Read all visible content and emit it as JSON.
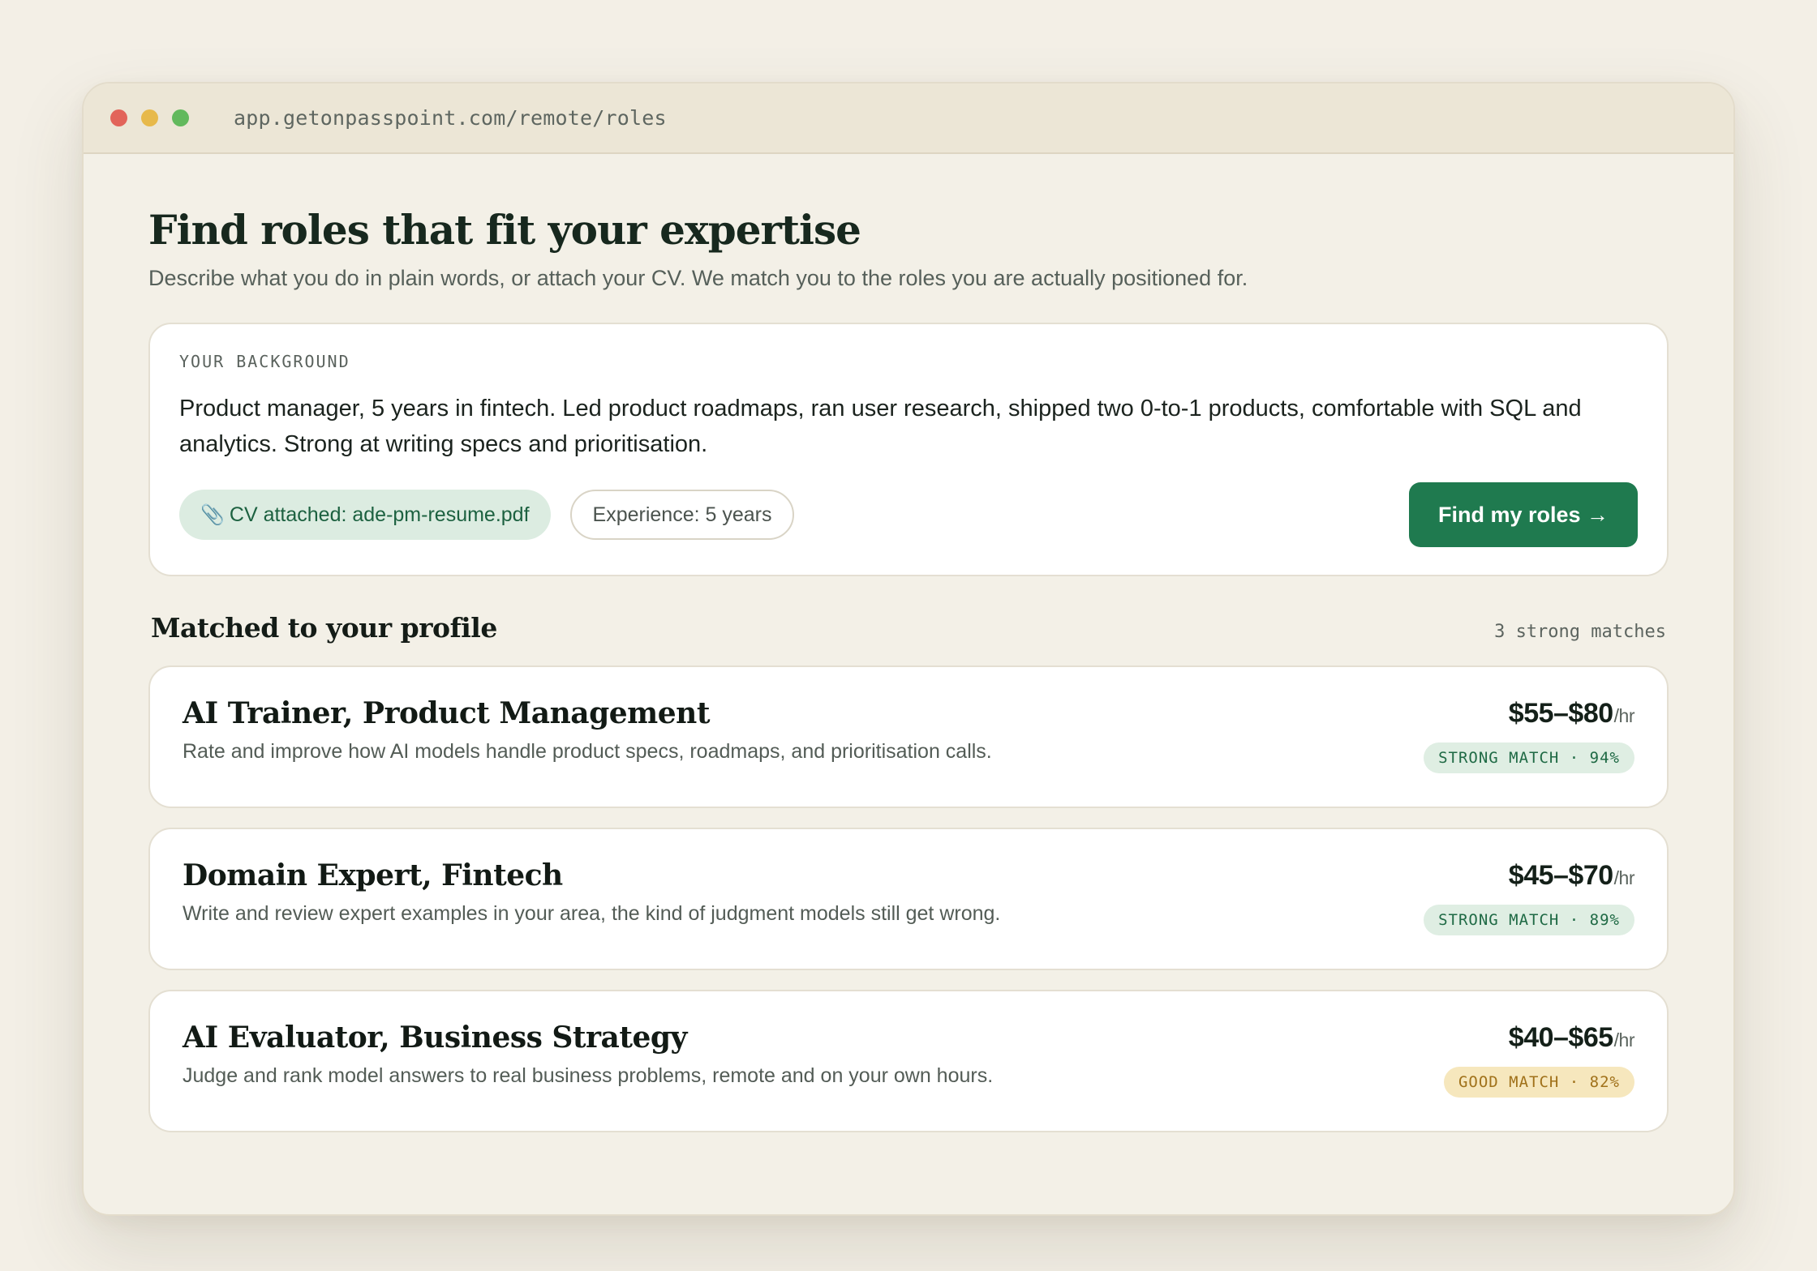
{
  "browser": {
    "url": "app.getonpasspoint.com/remote/roles"
  },
  "header": {
    "title": "Find roles that fit your expertise",
    "subtitle": "Describe what you do in plain words, or attach your CV. We match you to the roles you are actually positioned for."
  },
  "background": {
    "label": "YOUR BACKGROUND",
    "text": "Product manager, 5 years in fintech. Led product roadmaps, ran user research, shipped two 0-to-1 products, comfortable with SQL and analytics. Strong at writing specs and prioritisation.",
    "cv_chip": "CV attached: ade-pm-resume.pdf",
    "cv_icon": "paperclip-icon",
    "experience_chip": "Experience: 5 years",
    "find_button": "Find my roles →"
  },
  "matches": {
    "title": "Matched to your profile",
    "count": "3 strong matches",
    "roles": [
      {
        "title": "AI Trainer, Product Management",
        "description": "Rate and improve how AI models handle product specs, roadmaps, and prioritisation calls.",
        "rate": "$55–$80",
        "unit": "/hr",
        "badge": "STRONG MATCH · 94%",
        "badge_type": "strong"
      },
      {
        "title": "Domain Expert, Fintech",
        "description": "Write and review expert examples in your area, the kind of judgment models still get wrong.",
        "rate": "$45–$70",
        "unit": "/hr",
        "badge": "STRONG MATCH · 89%",
        "badge_type": "strong"
      },
      {
        "title": "AI Evaluator, Business Strategy",
        "description": "Judge and rank model answers to real business problems, remote and on your own hours.",
        "rate": "$40–$65",
        "unit": "/hr",
        "badge": "GOOD MATCH · 82%",
        "badge_type": "good"
      }
    ]
  },
  "colors": {
    "accent": "#1f7a4f",
    "strong_badge_bg": "#dfeee3",
    "good_badge_bg": "#f6e7bd",
    "page_bg": "#f3efe6"
  }
}
